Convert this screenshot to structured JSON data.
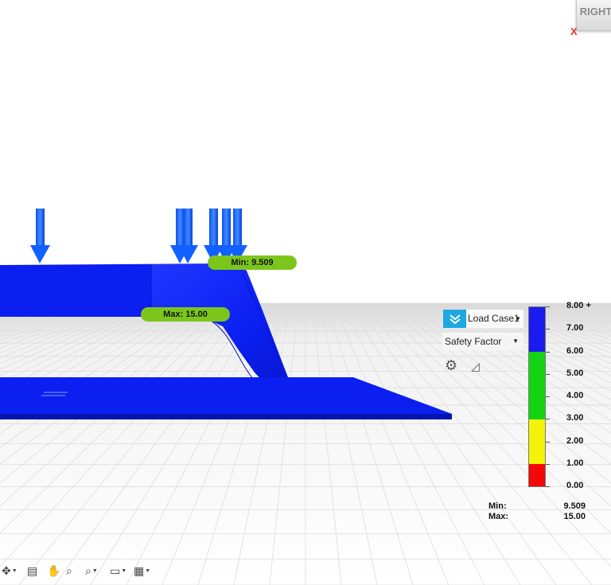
{
  "viewcube": {
    "face_label": "RIGHT",
    "axis_label": "X"
  },
  "model": {
    "min_marker_label": "Min: 9.509",
    "max_marker_label": "Max: 15.00",
    "load_arrow_count": 7,
    "body_color": "#0a1ff0"
  },
  "results_panel": {
    "load_case_icon": "double-chevron-down-icon",
    "load_case": "Load Case1",
    "result_type": "Safety Factor",
    "settings_icon": "gear-icon",
    "triangle_icon": "triangle-icon"
  },
  "legend": {
    "ticks": [
      "8.00 +",
      "7.00",
      "6.00",
      "5.00",
      "4.00",
      "3.00",
      "2.00",
      "1.00",
      "0.00"
    ],
    "bands": [
      {
        "range": [
          6,
          8
        ],
        "color": "#1b1bf0"
      },
      {
        "range": [
          3,
          6
        ],
        "color": "#13d412"
      },
      {
        "range": [
          1,
          3
        ],
        "color": "#f4f40a"
      },
      {
        "range": [
          0,
          1
        ],
        "color": "#f20808"
      }
    ],
    "min_label": "Min:",
    "min_value": "9.509",
    "max_label": "Max:",
    "max_value": "15.00"
  },
  "toolbar": {
    "items": [
      "orbit-icon",
      "look-at-icon",
      "pan-icon",
      "zoom-icon",
      "fit-zoom-icon",
      "display-settings-icon",
      "grid-settings-icon"
    ]
  }
}
